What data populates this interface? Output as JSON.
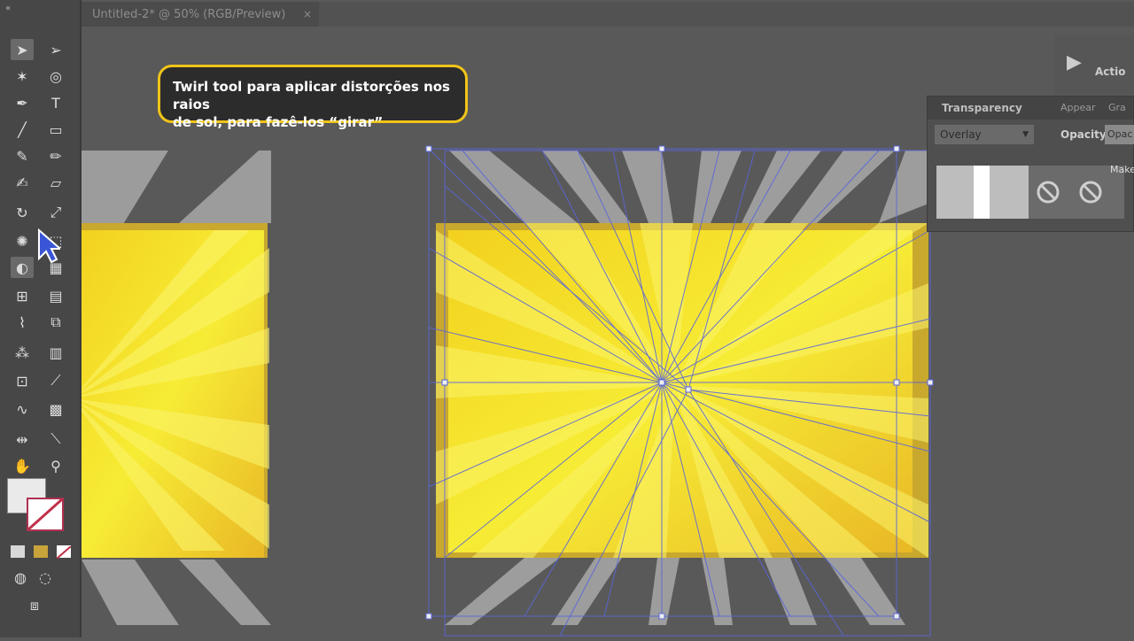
{
  "document_tab": {
    "title": "Untitled-2* @ 50% (RGB/Preview)",
    "close_label": "×"
  },
  "callout": {
    "line1": "Twirl tool para aplicar distorções nos raios",
    "line2": "de sol, para fazê-los “girar”"
  },
  "transparency_panel": {
    "title": "Transparency",
    "tab_appearance": "Appear",
    "tab_graphic": "Gra",
    "blend_mode": "Overlay",
    "opacity_label": "Opacity:",
    "opacity_value": "Opac",
    "make_mask_label": "Make"
  },
  "right_dock": {
    "actions_label": "Actio"
  },
  "colors": {
    "accent_callout_border": "#f0c419",
    "artwork_yellow": "#f5e12a",
    "artwork_orange": "#e8a51f",
    "selection_blue": "#5a66d8"
  },
  "tools": [
    "selection-tool",
    "direct-selection-tool",
    "magic-wand-tool",
    "lasso-tool",
    "pen-tool",
    "type-tool",
    "line-tool",
    "rectangle-tool",
    "paintbrush-tool",
    "pencil-tool",
    "blob-brush-tool",
    "eraser-tool",
    "rotate-tool",
    "scale-tool",
    "twirl-tool",
    "free-transform-tool",
    "shape-builder-tool",
    "perspective-grid-tool",
    "mesh-tool",
    "gradient-tool",
    "eyedropper-tool",
    "blend-tool",
    "symbol-sprayer-tool",
    "graph-tool",
    "artboard-tool",
    "slice-tool",
    "hand-tool",
    "zoom-tool"
  ]
}
